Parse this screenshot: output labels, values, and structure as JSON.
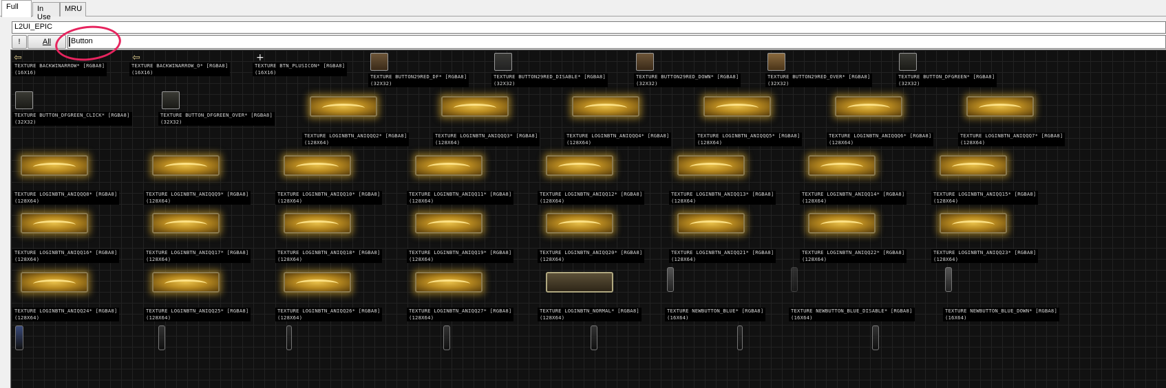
{
  "tabs": [
    {
      "label": "Full",
      "active": true
    },
    {
      "label": "In Use",
      "active": false
    },
    {
      "label": "MRU",
      "active": false
    }
  ],
  "package_field": {
    "value": "L2UI_EPIC"
  },
  "toolbar": {
    "exclaim_label": "!",
    "all_label": "All"
  },
  "filter_field": {
    "value": "Button"
  },
  "textures": [
    {
      "name": "TEXTURE BACKWINARROW* [RGBA8]",
      "size": "(16X16)"
    },
    {
      "name": "TEXTURE BACKWINARROW_O* [RGBA8]",
      "size": "(16X16)"
    },
    {
      "name": "TEXTURE BTN_PLUSICON* [RGBA8]",
      "size": "(16X16)"
    },
    {
      "name": "TEXTURE BUTTON29RED_DF* [RGBA8]",
      "size": "(32X32)"
    },
    {
      "name": "TEXTURE BUTTON29RED_DISABLE* [RGBA8]",
      "size": "(32X32)"
    },
    {
      "name": "TEXTURE BUTTON29RED_DOWN* [RGBA8]",
      "size": "(32X32)"
    },
    {
      "name": "TEXTURE BUTTON29RED_OVER* [RGBA8]",
      "size": "(32X32)"
    },
    {
      "name": "TEXTURE BUTTON_DFGREEN* [RGBA8]",
      "size": "(32X32)"
    },
    {
      "name": "TEXTURE BUTTON_DFGREEN_CLICK* [RGBA8]",
      "size": "(32X32)"
    },
    {
      "name": "TEXTURE BUTTON_DFGREEN_OVER* [RGBA8]",
      "size": "(32X32)"
    },
    {
      "name": "TEXTURE LOGINBTN_ANIQQQ2* [RGBA8]",
      "size": "(128X64)"
    },
    {
      "name": "TEXTURE LOGINBTN_ANIQQQ3* [RGBA8]",
      "size": "(128X64)"
    },
    {
      "name": "TEXTURE LOGINBTN_ANIQQQ4* [RGBA8]",
      "size": "(128X64)"
    },
    {
      "name": "TEXTURE LOGINBTN_ANIQQQ5* [RGBA8]",
      "size": "(128X64)"
    },
    {
      "name": "TEXTURE LOGINBTN_ANIQQQ6* [RGBA8]",
      "size": "(128X64)"
    },
    {
      "name": "TEXTURE LOGINBTN_ANIQQQ7* [RGBA8]",
      "size": "(128X64)"
    },
    {
      "name": "TEXTURE LOGINBTN_ANIQQQ8* [RGBA8]",
      "size": "(128X64)"
    },
    {
      "name": "TEXTURE LOGINBTN_ANIQQQ9* [RGBA8]",
      "size": "(128X64)"
    },
    {
      "name": "TEXTURE LOGINBTN_ANIQQ10* [RGBA8]",
      "size": "(128X64)"
    },
    {
      "name": "TEXTURE LOGINBTN_ANIQQ11* [RGBA8]",
      "size": "(128X64)"
    },
    {
      "name": "TEXTURE LOGINBTN_ANIQQ12* [RGBA8]",
      "size": "(128X64)"
    },
    {
      "name": "TEXTURE LOGINBTN_ANIQQ13* [RGBA8]",
      "size": "(128X64)"
    },
    {
      "name": "TEXTURE LOGINBTN_ANIQQ14* [RGBA8]",
      "size": "(128X64)"
    },
    {
      "name": "TEXTURE LOGINBTN_ANIQQ15* [RGBA8]",
      "size": "(128X64)"
    },
    {
      "name": "TEXTURE LOGINBTN_ANIQQ16* [RGBA8]",
      "size": "(128X64)"
    },
    {
      "name": "TEXTURE LOGINBTN_ANIQQ17* [RGBA8]",
      "size": "(128X64)"
    },
    {
      "name": "TEXTURE LOGINBTN_ANIQQ18* [RGBA8]",
      "size": "(128X64)"
    },
    {
      "name": "TEXTURE LOGINBTN_ANIQQ19* [RGBA8]",
      "size": "(128X64)"
    },
    {
      "name": "TEXTURE LOGINBTN_ANIQQ20* [RGBA8]",
      "size": "(128X64)"
    },
    {
      "name": "TEXTURE LOGINBTN_ANIQQ21* [RGBA8]",
      "size": "(128X64)"
    },
    {
      "name": "TEXTURE LOGINBTN_ANIQQ22* [RGBA8]",
      "size": "(128X64)"
    },
    {
      "name": "TEXTURE LOGINBTN_ANIQQ23* [RGBA8]",
      "size": "(128X64)"
    },
    {
      "name": "TEXTURE LOGINBTN_ANIQQ24* [RGBA8]",
      "size": "(128X64)"
    },
    {
      "name": "TEXTURE LOGINBTN_ANIQQ25* [RGBA8]",
      "size": "(128X64)"
    },
    {
      "name": "TEXTURE LOGINBTN_ANIQQ26* [RGBA8]",
      "size": "(128X64)"
    },
    {
      "name": "TEXTURE LOGINBTN_ANIQQ27* [RGBA8]",
      "size": "(128X64)"
    },
    {
      "name": "TEXTURE LOGINBTN_NORMAL* [RGBA8]",
      "size": "(128X64)"
    },
    {
      "name": "TEXTURE NEWBUTTON_BLUE* [RGBA8]",
      "size": "(16X64)"
    },
    {
      "name": "TEXTURE NEWBUTTON_BLUE_DISABLE* [RGBA8]",
      "size": "(16X64)"
    },
    {
      "name": "TEXTURE NEWBUTTON_BLUE_DOWN* [RGBA8]",
      "size": "(16X64)"
    }
  ],
  "colors": {
    "canvas_bg": "#111111",
    "grid_line": "#222222",
    "label_text": "#d8d8d8",
    "gold_glow": "#e6b432",
    "annotation_circle": "#e6245e"
  }
}
